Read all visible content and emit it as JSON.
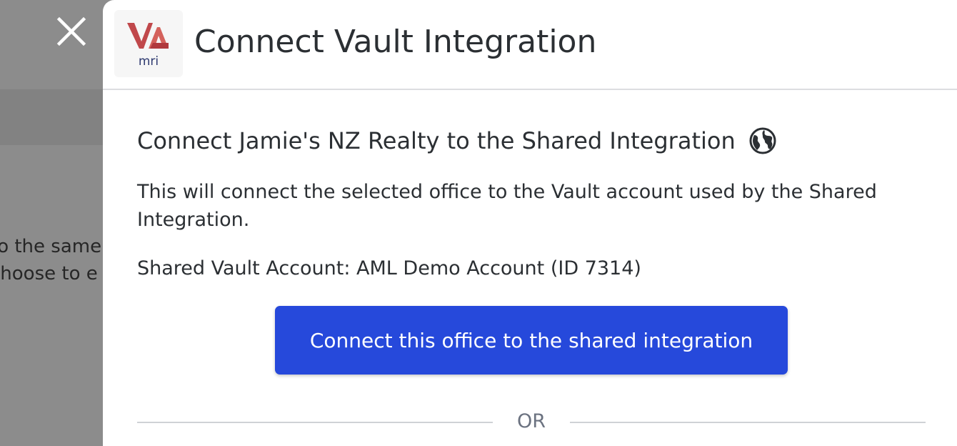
{
  "background": {
    "text_line_1": "to the same",
    "text_line_2": "choose to e"
  },
  "close_button": {
    "icon": "close-icon"
  },
  "drawer": {
    "logo": {
      "sub_text": "mri",
      "letters": "VA",
      "accent_color": "#c0484b"
    },
    "title": "Connect Vault Integration",
    "section": {
      "heading": "Connect Jamie's NZ Realty to the Shared Integration",
      "heading_icon": "globe-icon",
      "description": "This will connect the selected office to the Vault account used by the Shared Integration.",
      "account_line": "Shared Vault Account: AML Demo Account (ID 7314)"
    },
    "connect_button_label": "Connect this office to the shared integration",
    "divider_label": "OR"
  },
  "colors": {
    "primary": "#2649db",
    "text": "#2b2f33",
    "overlay": "#8c8c8c",
    "muted": "#6b7280"
  }
}
